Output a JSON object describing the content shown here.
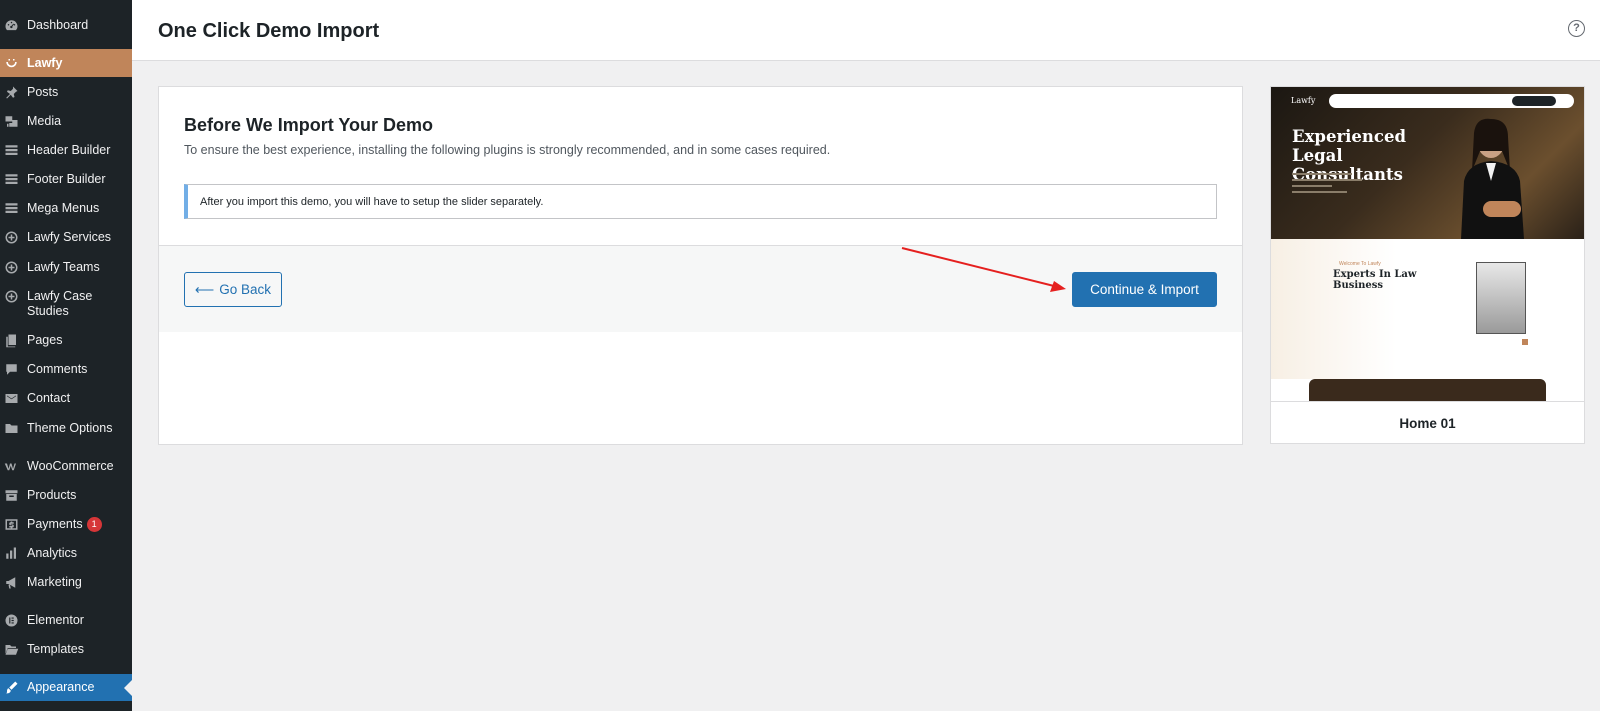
{
  "sidebar": {
    "items": [
      {
        "label": "Dashboard",
        "icon": "dashboard-icon"
      },
      {
        "label": "Lawfy",
        "icon": "lawfy-icon"
      },
      {
        "label": "Posts",
        "icon": "pin-icon"
      },
      {
        "label": "Media",
        "icon": "media-icon"
      },
      {
        "label": "Header Builder",
        "icon": "menu-icon"
      },
      {
        "label": "Footer Builder",
        "icon": "menu-icon"
      },
      {
        "label": "Mega Menus",
        "icon": "menu-icon"
      },
      {
        "label": "Lawfy Services",
        "icon": "plus-circle-icon"
      },
      {
        "label": "Lawfy Teams",
        "icon": "plus-circle-icon"
      },
      {
        "label": "Lawfy Case Studies",
        "icon": "plus-circle-icon"
      },
      {
        "label": "Pages",
        "icon": "pages-icon"
      },
      {
        "label": "Comments",
        "icon": "comment-icon"
      },
      {
        "label": "Contact",
        "icon": "mail-icon"
      },
      {
        "label": "Theme Options",
        "icon": "folder-icon"
      },
      {
        "label": "WooCommerce",
        "icon": "woo-icon"
      },
      {
        "label": "Products",
        "icon": "archive-icon"
      },
      {
        "label": "Payments",
        "icon": "dollar-icon",
        "badge": "1"
      },
      {
        "label": "Analytics",
        "icon": "chart-icon"
      },
      {
        "label": "Marketing",
        "icon": "megaphone-icon"
      },
      {
        "label": "Elementor",
        "icon": "elementor-icon"
      },
      {
        "label": "Templates",
        "icon": "folder-open-icon"
      },
      {
        "label": "Appearance",
        "icon": "brush-icon"
      }
    ],
    "active_highlight": "#c0855a",
    "current_highlight": "#2271b1"
  },
  "header": {
    "title": "One Click Demo Import",
    "help_icon": "?"
  },
  "main": {
    "title": "Before We Import Your Demo",
    "description": "To ensure the best experience, installing the following plugins is strongly recommended, and in some cases required.",
    "notice": "After you import this demo, you will have to setup the slider separately.",
    "back_arrow": "⟵",
    "back_label": "Go Back",
    "continue_label": "Continue & Import"
  },
  "preview": {
    "label": "Home 01",
    "hero_logo": "Lawfy",
    "hero_title": "Experienced Legal Consultants",
    "section_small": "Welcome To Lawfy",
    "section_title": "Experts In Law Business"
  },
  "colors": {
    "primary": "#2271b1",
    "sidebar_bg": "#1d2327",
    "annotation_arrow": "#e5201f"
  }
}
